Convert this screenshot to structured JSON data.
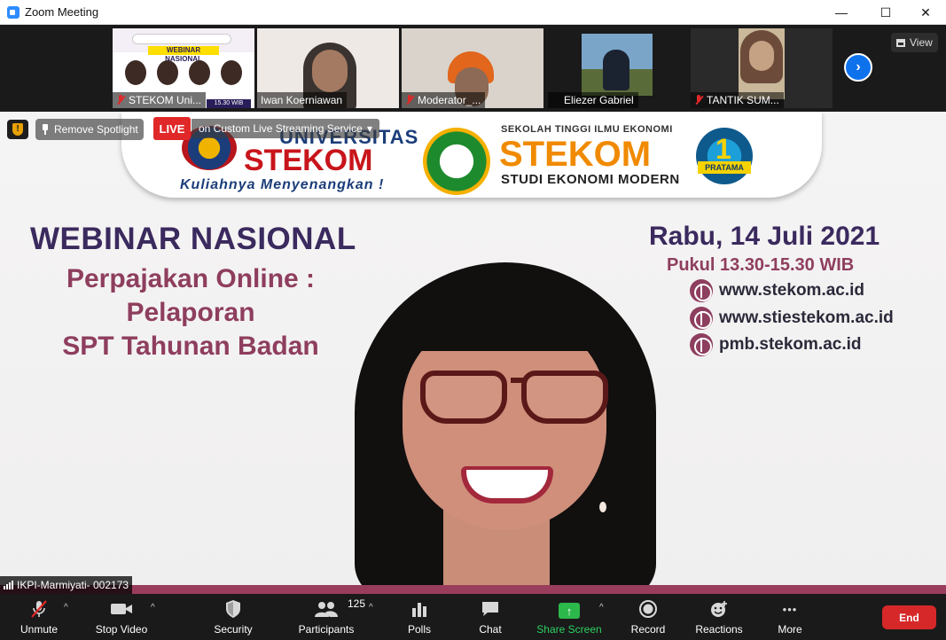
{
  "window": {
    "title": "Zoom Meeting",
    "minimize": "—",
    "maximize": "☐",
    "close": "✕"
  },
  "thumbnails": [
    {
      "name": "STEKOM Uni...",
      "muted": true,
      "overlay_text": "WEBINAR NASIONAL",
      "time_chip": "15.30 WIB"
    },
    {
      "name": "Iwan Koerniawan",
      "muted": false
    },
    {
      "name": "Moderator_...",
      "muted": true
    },
    {
      "name": "Eliezer Gabriel",
      "muted": true
    },
    {
      "name": "TANTIK SUM...",
      "muted": true
    }
  ],
  "view_button": {
    "label": "View"
  },
  "next_icon": "›",
  "spotlight": {
    "remove_label": "Remove Spotlight",
    "live_badge": "LIVE",
    "live_service": "on Custom Live Streaming Service",
    "live_caret": "▾",
    "shield_glyph": "!",
    "speaker_name": "IKPI-Marmiyati- 002173"
  },
  "slide": {
    "uni_top": "UNIVERSITAS",
    "uni_name": "STEKOM",
    "uni_tagline": "Kuliahnya Menyenangkan !",
    "school_top": "SEKOLAH TINGGI ILMU EKONOMI",
    "school_name": "STEKOM",
    "school_sub": "STUDI EKONOMI MODERN",
    "poltek_num": "1",
    "poltek_name": "PRATAMA",
    "heading": "WEBINAR NASIONAL",
    "topic_line1": "Perpajakan Online :",
    "topic_line2": "Pelaporan",
    "topic_line3": "SPT Tahunan Badan",
    "date": "Rabu, 14 Juli 2021",
    "time": "Pukul 13.30-15.30 WIB",
    "urls": [
      "www.stekom.ac.id",
      "www.stiestekom.ac.id",
      "pmb.stekom.ac.id"
    ]
  },
  "toolbar": {
    "unmute": "Unmute",
    "stop_video": "Stop Video",
    "security": "Security",
    "participants": "Participants",
    "participants_count": "125",
    "polls": "Polls",
    "chat": "Chat",
    "share_screen": "Share Screen",
    "record": "Record",
    "reactions": "Reactions",
    "more": "More",
    "end": "End",
    "caret": "^",
    "glyphs": {
      "security": "⛨",
      "chat": "▬",
      "share": "↑",
      "record": "◉",
      "reactions": "☺",
      "more": "•••",
      "polls": "▮▮▮",
      "video": "■",
      "mic": "🎙"
    }
  }
}
